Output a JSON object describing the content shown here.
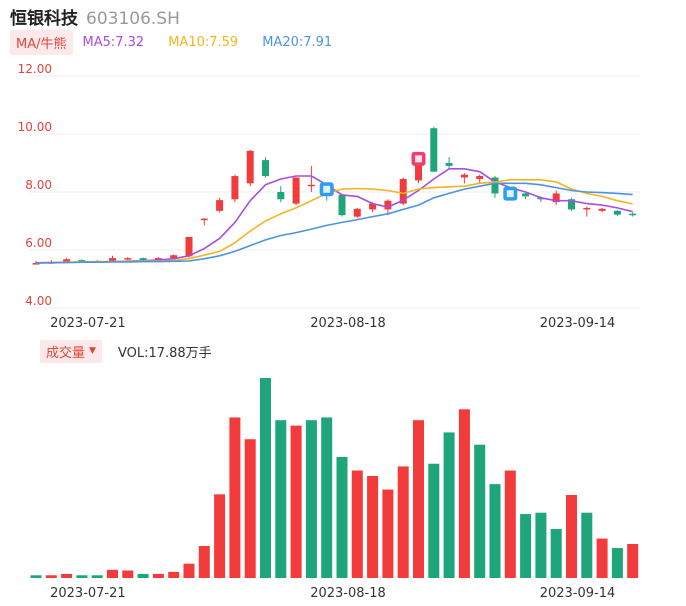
{
  "header": {
    "name": "恒银科技",
    "code": "603106.SH"
  },
  "ma_bar": {
    "toggle_label": "MA/牛熊",
    "items": [
      {
        "label": "MA5:7.32",
        "color": "#a64ee0"
      },
      {
        "label": "MA10:7.59",
        "color": "#f2b51d"
      },
      {
        "label": "MA20:7.91",
        "color": "#4a94e2"
      }
    ]
  },
  "volume_bar": {
    "toggle_label": "成交量",
    "caret": "▼",
    "label": "VOL:17.88万手"
  },
  "colors": {
    "up": "#f23b3b",
    "down": "#1fa57a",
    "grid": "#eeeeee",
    "axis_label": "#e0463c",
    "date_label": "#333333"
  },
  "markers": [
    {
      "index": 19,
      "icon": "blue-badge-icon",
      "color": "#2a9df4"
    },
    {
      "index": 25,
      "icon": "red-badge-icon",
      "color": "#f23b6e"
    },
    {
      "index": 31,
      "icon": "blue-badge-icon",
      "color": "#2a9df4"
    }
  ],
  "chart_data": [
    {
      "type": "candlestick",
      "ylim": [
        4.0,
        12.0
      ],
      "y_ticks": [
        "12.00",
        "10.00",
        "8.00",
        "6.00",
        "4.00"
      ],
      "x_tick_labels": [
        {
          "index": 3,
          "label": "2023-07-21"
        },
        {
          "index": 20,
          "label": "2023-08-18"
        },
        {
          "index": 35,
          "label": "2023-09-14"
        }
      ],
      "candles": [
        {
          "o": 5.55,
          "h": 5.62,
          "l": 5.5,
          "c": 5.55
        },
        {
          "o": 5.57,
          "h": 5.65,
          "l": 5.52,
          "c": 5.58
        },
        {
          "o": 5.58,
          "h": 5.72,
          "l": 5.55,
          "c": 5.68
        },
        {
          "o": 5.65,
          "h": 5.68,
          "l": 5.58,
          "c": 5.62
        },
        {
          "o": 5.62,
          "h": 5.66,
          "l": 5.58,
          "c": 5.6
        },
        {
          "o": 5.62,
          "h": 5.8,
          "l": 5.58,
          "c": 5.72
        },
        {
          "o": 5.68,
          "h": 5.76,
          "l": 5.65,
          "c": 5.72
        },
        {
          "o": 5.72,
          "h": 5.74,
          "l": 5.62,
          "c": 5.66
        },
        {
          "o": 5.68,
          "h": 5.76,
          "l": 5.64,
          "c": 5.72
        },
        {
          "o": 5.72,
          "h": 5.85,
          "l": 5.68,
          "c": 5.82
        },
        {
          "o": 5.78,
          "h": 6.45,
          "l": 5.74,
          "c": 6.45
        },
        {
          "o": 7.05,
          "h": 7.1,
          "l": 6.85,
          "c": 7.08
        },
        {
          "o": 7.35,
          "h": 7.8,
          "l": 7.3,
          "c": 7.72
        },
        {
          "o": 7.75,
          "h": 8.6,
          "l": 7.65,
          "c": 8.55
        },
        {
          "o": 8.3,
          "h": 9.45,
          "l": 8.2,
          "c": 9.42
        },
        {
          "o": 9.1,
          "h": 9.2,
          "l": 8.5,
          "c": 8.55
        },
        {
          "o": 8.0,
          "h": 8.2,
          "l": 7.65,
          "c": 7.75
        },
        {
          "o": 7.6,
          "h": 8.5,
          "l": 7.55,
          "c": 8.5
        },
        {
          "o": 8.2,
          "h": 8.9,
          "l": 8.0,
          "c": 8.25
        },
        {
          "o": 8.2,
          "h": 8.3,
          "l": 7.7,
          "c": 7.9
        },
        {
          "o": 7.9,
          "h": 7.95,
          "l": 7.15,
          "c": 7.2
        },
        {
          "o": 7.15,
          "h": 7.45,
          "l": 7.1,
          "c": 7.42
        },
        {
          "o": 7.4,
          "h": 7.65,
          "l": 7.3,
          "c": 7.6
        },
        {
          "o": 7.4,
          "h": 7.75,
          "l": 7.2,
          "c": 7.7
        },
        {
          "o": 7.6,
          "h": 8.5,
          "l": 7.55,
          "c": 8.45
        },
        {
          "o": 8.4,
          "h": 9.35,
          "l": 8.3,
          "c": 9.3
        },
        {
          "o": 10.2,
          "h": 10.25,
          "l": 8.7,
          "c": 8.7
        },
        {
          "o": 9.0,
          "h": 9.2,
          "l": 8.8,
          "c": 8.9
        },
        {
          "o": 8.5,
          "h": 8.65,
          "l": 8.3,
          "c": 8.6
        },
        {
          "o": 8.45,
          "h": 8.6,
          "l": 8.3,
          "c": 8.55
        },
        {
          "o": 8.5,
          "h": 8.55,
          "l": 7.8,
          "c": 7.95
        },
        {
          "o": 7.9,
          "h": 8.15,
          "l": 7.85,
          "c": 7.95
        },
        {
          "o": 7.95,
          "h": 8.0,
          "l": 7.75,
          "c": 7.85
        },
        {
          "o": 7.8,
          "h": 7.85,
          "l": 7.65,
          "c": 7.75
        },
        {
          "o": 7.65,
          "h": 8.05,
          "l": 7.55,
          "c": 7.95
        },
        {
          "o": 7.75,
          "h": 7.8,
          "l": 7.35,
          "c": 7.4
        },
        {
          "o": 7.4,
          "h": 7.5,
          "l": 7.15,
          "c": 7.45
        },
        {
          "o": 7.35,
          "h": 7.45,
          "l": 7.3,
          "c": 7.42
        },
        {
          "o": 7.35,
          "h": 7.38,
          "l": 7.18,
          "c": 7.22
        },
        {
          "o": 7.25,
          "h": 7.3,
          "l": 7.15,
          "c": 7.2
        }
      ],
      "series": [
        {
          "name": "MA5",
          "values": [
            5.55,
            5.56,
            5.57,
            5.58,
            5.58,
            5.6,
            5.62,
            5.63,
            5.65,
            5.7,
            5.8,
            6.05,
            6.4,
            6.95,
            7.7,
            8.25,
            8.45,
            8.55,
            8.55,
            8.25,
            7.9,
            7.85,
            7.6,
            7.48,
            7.72,
            8.05,
            8.45,
            8.8,
            8.8,
            8.7,
            8.35,
            8.15,
            8.0,
            7.8,
            7.7,
            7.7,
            7.6,
            7.55,
            7.45,
            7.32
          ]
        },
        {
          "name": "MA10",
          "values": [
            5.56,
            5.57,
            5.58,
            5.59,
            5.6,
            5.6,
            5.61,
            5.62,
            5.62,
            5.64,
            5.7,
            5.82,
            5.95,
            6.25,
            6.65,
            7.0,
            7.25,
            7.45,
            7.7,
            7.95,
            8.1,
            8.12,
            8.1,
            8.05,
            7.95,
            8.1,
            8.15,
            8.18,
            8.2,
            8.3,
            8.35,
            8.42,
            8.42,
            8.42,
            8.35,
            8.1,
            7.95,
            7.85,
            7.7,
            7.59
          ]
        },
        {
          "name": "MA20",
          "values": [
            5.56,
            5.57,
            5.57,
            5.58,
            5.58,
            5.59,
            5.59,
            5.6,
            5.6,
            5.61,
            5.62,
            5.7,
            5.8,
            5.95,
            6.15,
            6.35,
            6.5,
            6.6,
            6.72,
            6.85,
            6.95,
            7.05,
            7.15,
            7.25,
            7.4,
            7.55,
            7.8,
            7.95,
            8.1,
            8.2,
            8.3,
            8.3,
            8.3,
            8.25,
            8.15,
            8.05,
            8.0,
            7.98,
            7.95,
            7.91
          ]
        }
      ]
    },
    {
      "type": "bar",
      "title": "成交量",
      "x_tick_labels": [
        {
          "index": 3,
          "label": "2023-07-21"
        },
        {
          "index": 20,
          "label": "2023-08-18"
        },
        {
          "index": 35,
          "label": "2023-09-14"
        }
      ],
      "values": [
        2.0,
        2.0,
        3.0,
        2.0,
        2.0,
        6.0,
        5.5,
        3.0,
        3.0,
        4.5,
        10.5,
        23.5,
        61.5,
        118.0,
        102.0,
        147.0,
        116.0,
        112.0,
        116.0,
        118.0,
        89.0,
        79.0,
        75.0,
        65.0,
        82.0,
        116.0,
        84.0,
        107.0,
        124.0,
        98.0,
        69.0,
        79.0,
        47.0,
        48.0,
        36.0,
        61.0,
        48.0,
        29.0,
        22.0,
        25.0
      ],
      "directions": [
        "down",
        "up",
        "up",
        "down",
        "down",
        "up",
        "up",
        "down",
        "up",
        "up",
        "up",
        "up",
        "up",
        "up",
        "up",
        "down",
        "down",
        "up",
        "down",
        "down",
        "down",
        "up",
        "up",
        "up",
        "up",
        "up",
        "down",
        "down",
        "up",
        "down",
        "down",
        "up",
        "down",
        "down",
        "down",
        "up",
        "down",
        "up",
        "down",
        "up"
      ]
    }
  ]
}
